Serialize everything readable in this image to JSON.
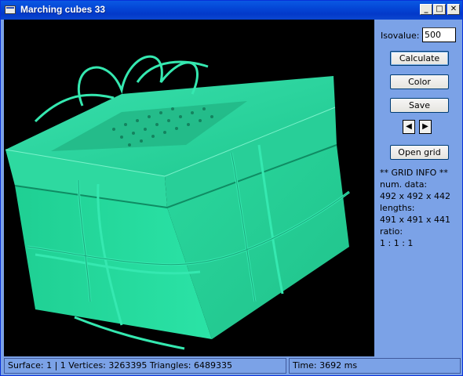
{
  "window": {
    "title": "Marching cubes 33"
  },
  "titlebar_buttons": {
    "minimize": "_",
    "maximize": "□",
    "close": "✕"
  },
  "icons": {
    "app": "window-icon",
    "prev": "left-triangle",
    "next": "right-triangle"
  },
  "colors": {
    "mesh": "#2edfa3",
    "viewport_bg": "#000000",
    "panel_bg": "#7ba2e7",
    "titlebar": "#0446d6"
  },
  "panel": {
    "isovalue_label": "Isovalue:",
    "isovalue_value": "500",
    "calculate_label": "Calculate",
    "color_label": "Color",
    "save_label": "Save",
    "prev_label": "◀",
    "next_label": "▶",
    "open_grid_label": "Open grid"
  },
  "grid_info": {
    "header": "** GRID  INFO **",
    "num_data_label": "num. data:",
    "num_data": "492 x 492 x 442",
    "lengths_label": "lengths:",
    "lengths": "491 x 491 x 441",
    "ratio_label": "ratio:",
    "ratio": "1 : 1 : 1"
  },
  "status": {
    "left": "Surface: 1 | 1   Vertices: 3263395   Triangles: 6489335",
    "right": "Time: 3692 ms"
  }
}
